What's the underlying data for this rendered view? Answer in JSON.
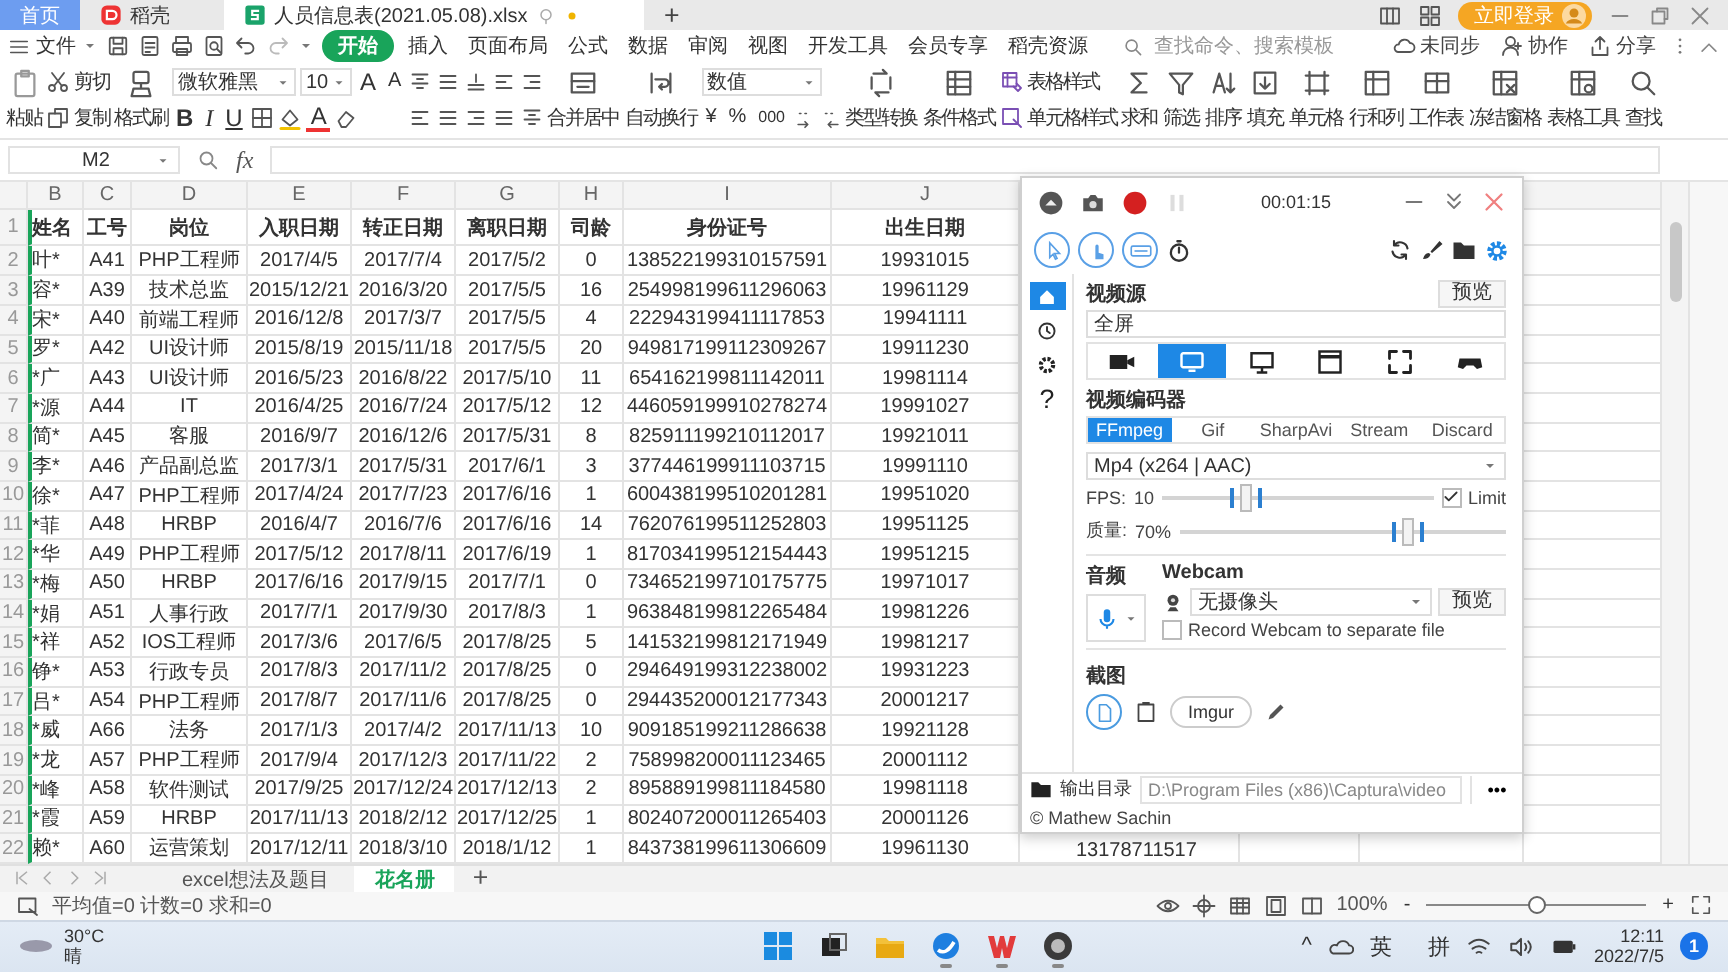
{
  "titlebar": {
    "tabs": [
      {
        "label": "首页",
        "kind": "home",
        "selected": false
      },
      {
        "label": "稻壳",
        "kind": "docer",
        "selected": false
      },
      {
        "label": "人员信息表(2021.05.08).xlsx",
        "kind": "sheet",
        "selected": true
      }
    ],
    "new_tab": "+",
    "login": "立即登录"
  },
  "menubar": {
    "file": "文件",
    "items": [
      {
        "label": "开始",
        "selected": true
      },
      {
        "label": "插入",
        "selected": false
      },
      {
        "label": "页面布局",
        "selected": false
      },
      {
        "label": "公式",
        "selected": false
      },
      {
        "label": "数据",
        "selected": false
      },
      {
        "label": "审阅",
        "selected": false
      },
      {
        "label": "视图",
        "selected": false
      },
      {
        "label": "开发工具",
        "selected": false
      },
      {
        "label": "会员专享",
        "selected": false
      },
      {
        "label": "稻壳资源",
        "selected": false
      }
    ],
    "search": {
      "placeholder": "查找命令、搜索模板"
    },
    "sync": "未同步",
    "collaborate": "协作",
    "share": "分享"
  },
  "ribbon": {
    "paste": "粘贴",
    "cut": "剪切",
    "copy": "复制",
    "format_painter": "格式刷",
    "font": "微软雅黑",
    "font_size": "10",
    "grow": "A",
    "shrink": "A",
    "bold": "B",
    "italic": "I",
    "underline": "U",
    "font_color": "A",
    "merge": "合并居中",
    "wrap": "自动换行",
    "number_format": "数值",
    "currency": "¥",
    "percent": "%",
    "thousands": "000",
    "tools_a": [
      {
        "kind": "convert",
        "label": "类型转换"
      },
      {
        "kind": "conditional",
        "label": "条件格式"
      }
    ],
    "styles": {
      "table": "表格样式",
      "cell": "单元格样式"
    },
    "tools_b": [
      {
        "kind": "sum",
        "label": "求和"
      },
      {
        "kind": "filter",
        "label": "筛选"
      },
      {
        "kind": "sort",
        "label": "排序"
      },
      {
        "kind": "fill",
        "label": "填充"
      },
      {
        "kind": "cells",
        "label": "单元格"
      },
      {
        "kind": "rowcol",
        "label": "行和列"
      },
      {
        "kind": "sheet",
        "label": "工作表"
      },
      {
        "kind": "freeze",
        "label": "冻结窗格"
      },
      {
        "kind": "tabletools",
        "label": "表格工具"
      },
      {
        "kind": "find",
        "label": "查找"
      }
    ]
  },
  "formula_bar": {
    "cell": "M2",
    "fx": "fx"
  },
  "sheet": {
    "columns": [
      "B",
      "C",
      "D",
      "E",
      "F",
      "G",
      "H",
      "I",
      "J"
    ],
    "rows": [
      {
        "number": "1",
        "kind": "header",
        "cells": [
          "姓名",
          "工号",
          "岗位",
          "入职日期",
          "转正日期",
          "离职日期",
          "司龄",
          "身份证号",
          "出生日期"
        ]
      },
      {
        "number": "2",
        "kind": "data",
        "cells": [
          "叶*",
          "A41",
          "PHP工程师",
          "2017/4/5",
          "2017/7/4",
          "2017/5/2",
          "0",
          "138522199310157591",
          "19931015"
        ]
      },
      {
        "number": "3",
        "kind": "data",
        "cells": [
          "容*",
          "A39",
          "技术总监",
          "2015/12/21",
          "2016/3/20",
          "2017/5/5",
          "16",
          "254998199611296063",
          "19961129"
        ]
      },
      {
        "number": "4",
        "kind": "data",
        "cells": [
          "宋*",
          "A40",
          "前端工程师",
          "2016/12/8",
          "2017/3/7",
          "2017/5/5",
          "4",
          "222943199411117853",
          "19941111"
        ]
      },
      {
        "number": "5",
        "kind": "data",
        "cells": [
          "罗*",
          "A42",
          "UI设计师",
          "2015/8/19",
          "2015/11/18",
          "2017/5/5",
          "20",
          "949817199112309267",
          "19911230"
        ]
      },
      {
        "number": "6",
        "kind": "data",
        "cells": [
          "*广",
          "A43",
          "UI设计师",
          "2016/5/23",
          "2016/8/22",
          "2017/5/10",
          "11",
          "654162199811142011",
          "19981114"
        ]
      },
      {
        "number": "7",
        "kind": "data",
        "cells": [
          "*源",
          "A44",
          "IT",
          "2016/4/25",
          "2016/7/24",
          "2017/5/12",
          "12",
          "446059199910278274",
          "19991027"
        ]
      },
      {
        "number": "8",
        "kind": "data",
        "cells": [
          "简*",
          "A45",
          "客服",
          "2016/9/7",
          "2016/12/6",
          "2017/5/31",
          "8",
          "825911199210112017",
          "19921011"
        ]
      },
      {
        "number": "9",
        "kind": "data",
        "cells": [
          "李*",
          "A46",
          "产品副总监",
          "2017/3/1",
          "2017/5/31",
          "2017/6/1",
          "3",
          "377446199911103715",
          "19991110"
        ]
      },
      {
        "number": "10",
        "kind": "data",
        "cells": [
          "徐*",
          "A47",
          "PHP工程师",
          "2017/4/24",
          "2017/7/23",
          "2017/6/16",
          "1",
          "600438199510201281",
          "19951020"
        ]
      },
      {
        "number": "11",
        "kind": "data",
        "cells": [
          "*菲",
          "A48",
          "HRBP",
          "2016/4/7",
          "2016/7/6",
          "2017/6/16",
          "14",
          "762076199511252803",
          "19951125"
        ]
      },
      {
        "number": "12",
        "kind": "data",
        "cells": [
          "*华",
          "A49",
          "PHP工程师",
          "2017/5/12",
          "2017/8/11",
          "2017/6/19",
          "1",
          "817034199512154443",
          "19951215"
        ]
      },
      {
        "number": "13",
        "kind": "data",
        "cells": [
          "*梅",
          "A50",
          "HRBP",
          "2017/6/16",
          "2017/9/15",
          "2017/7/1",
          "0",
          "734652199710175775",
          "19971017"
        ]
      },
      {
        "number": "14",
        "kind": "data",
        "cells": [
          "*娟",
          "A51",
          "人事行政",
          "2017/7/1",
          "2017/9/30",
          "2017/8/3",
          "1",
          "963848199812265484",
          "19981226"
        ]
      },
      {
        "number": "15",
        "kind": "data",
        "cells": [
          "*祥",
          "A52",
          "IOS工程师",
          "2017/3/6",
          "2017/6/5",
          "2017/8/25",
          "5",
          "141532199812171949",
          "19981217"
        ]
      },
      {
        "number": "16",
        "kind": "data",
        "cells": [
          "铮*",
          "A53",
          "行政专员",
          "2017/8/3",
          "2017/11/2",
          "2017/8/25",
          "0",
          "294649199312238002",
          "19931223"
        ]
      },
      {
        "number": "17",
        "kind": "data",
        "cells": [
          "吕*",
          "A54",
          "PHP工程师",
          "2017/8/7",
          "2017/11/6",
          "2017/8/25",
          "0",
          "294435200012177343",
          "20001217"
        ]
      },
      {
        "number": "18",
        "kind": "data",
        "cells": [
          "*威",
          "A66",
          "法务",
          "2017/1/3",
          "2017/4/2",
          "2017/11/13",
          "10",
          "909185199211286638",
          "19921128"
        ]
      },
      {
        "number": "19",
        "kind": "data",
        "cells": [
          "*龙",
          "A57",
          "PHP工程师",
          "2017/9/4",
          "2017/12/3",
          "2017/11/22",
          "2",
          "758998200011123465",
          "20001112"
        ]
      },
      {
        "number": "20",
        "kind": "data",
        "cells": [
          "*峰",
          "A58",
          "软件测试",
          "2017/9/25",
          "2017/12/24",
          "2017/12/13",
          "2",
          "895889199811184580",
          "19981118"
        ]
      },
      {
        "number": "21",
        "kind": "data",
        "cells": [
          "*霞",
          "A59",
          "HRBP",
          "2017/11/13",
          "2018/2/12",
          "2017/12/25",
          "1",
          "802407200011265403",
          "20001126"
        ]
      },
      {
        "number": "22",
        "kind": "data",
        "cells": [
          "赖*",
          "A60",
          "运营策划",
          "2017/12/11",
          "2018/3/10",
          "2018/1/12",
          "1",
          "843738199611306609",
          "19961130",
          "13178711517"
        ]
      }
    ]
  },
  "sheet_tabs": {
    "tabs": [
      {
        "label": "excel想法及题目",
        "selected": false
      },
      {
        "label": "花名册",
        "selected": true
      }
    ],
    "add": "+"
  },
  "status_bar": {
    "summary": "平均值=0 计数=0 求和=0",
    "zoom": "100%",
    "zoom_out": "-",
    "zoom_in": "+",
    "zoom_slider": {
      "level": 0.5
    }
  },
  "taskbar": {
    "temperature": "30°C",
    "weather": "晴",
    "apps": [
      {
        "kind": "start",
        "running": false
      },
      {
        "kind": "taskview",
        "running": false
      },
      {
        "kind": "explorer",
        "running": false
      },
      {
        "kind": "browser",
        "running": true
      },
      {
        "kind": "wps",
        "running": true
      },
      {
        "kind": "captura",
        "running": true
      }
    ],
    "chevron": "^",
    "ime_lang": "英",
    "ime_mode": "拼",
    "time": "12:11",
    "date": "2022/7/5",
    "notifications": "1"
  },
  "recorder": {
    "timer": "00:01:15",
    "capture_modes": [
      {
        "kind": "cursor"
      },
      {
        "kind": "clicks"
      },
      {
        "kind": "keys"
      }
    ],
    "nav": [
      {
        "kind": "home",
        "selected": true
      },
      {
        "kind": "history",
        "selected": false
      },
      {
        "kind": "settings",
        "selected": false
      },
      {
        "kind": "help",
        "label": "?",
        "selected": false
      }
    ],
    "video_source": {
      "label": "视频源",
      "preview": "预览",
      "value": "全屏",
      "sources": [
        {
          "kind": "webcam",
          "selected": false
        },
        {
          "kind": "screen",
          "selected": true
        },
        {
          "kind": "monitor",
          "selected": false
        },
        {
          "kind": "window",
          "selected": false
        },
        {
          "kind": "region",
          "selected": false
        },
        {
          "kind": "game",
          "selected": false
        }
      ]
    },
    "encoder": {
      "label": "视频编码器",
      "tabs": [
        {
          "label": "FFmpeg",
          "selected": true
        },
        {
          "label": "Gif",
          "selected": false
        },
        {
          "label": "SharpAvi",
          "selected": false
        },
        {
          "label": "Stream",
          "selected": false
        },
        {
          "label": "Discard",
          "selected": false
        }
      ],
      "format": "Mp4 (x264 | AAC)",
      "fps_label": "FPS:",
      "fps": "10",
      "fps_slider": {
        "level": 0.31
      },
      "limit": {
        "label": "Limit",
        "checked": true
      },
      "quality_label": "质量:",
      "quality": "70%",
      "quality_slider": {
        "level": 0.7
      }
    },
    "audio": {
      "label": "音频"
    },
    "webcam": {
      "label": "Webcam",
      "value": "无摄像头",
      "preview": "预览",
      "separate": {
        "label": "Record Webcam to separate file",
        "checked": false
      }
    },
    "screenshot": {
      "label": "截图",
      "targets": [
        {
          "kind": "file",
          "selected": true
        },
        {
          "kind": "clipboard",
          "selected": false
        },
        {
          "kind": "imgur",
          "label": "Imgur",
          "selected": false
        },
        {
          "kind": "editor",
          "selected": false
        }
      ]
    },
    "output": {
      "label": "输出目录",
      "path": "D:\\Program Files (x86)\\Captura\\video",
      "more": "•••"
    },
    "footer": "© Mathew Sachin"
  }
}
